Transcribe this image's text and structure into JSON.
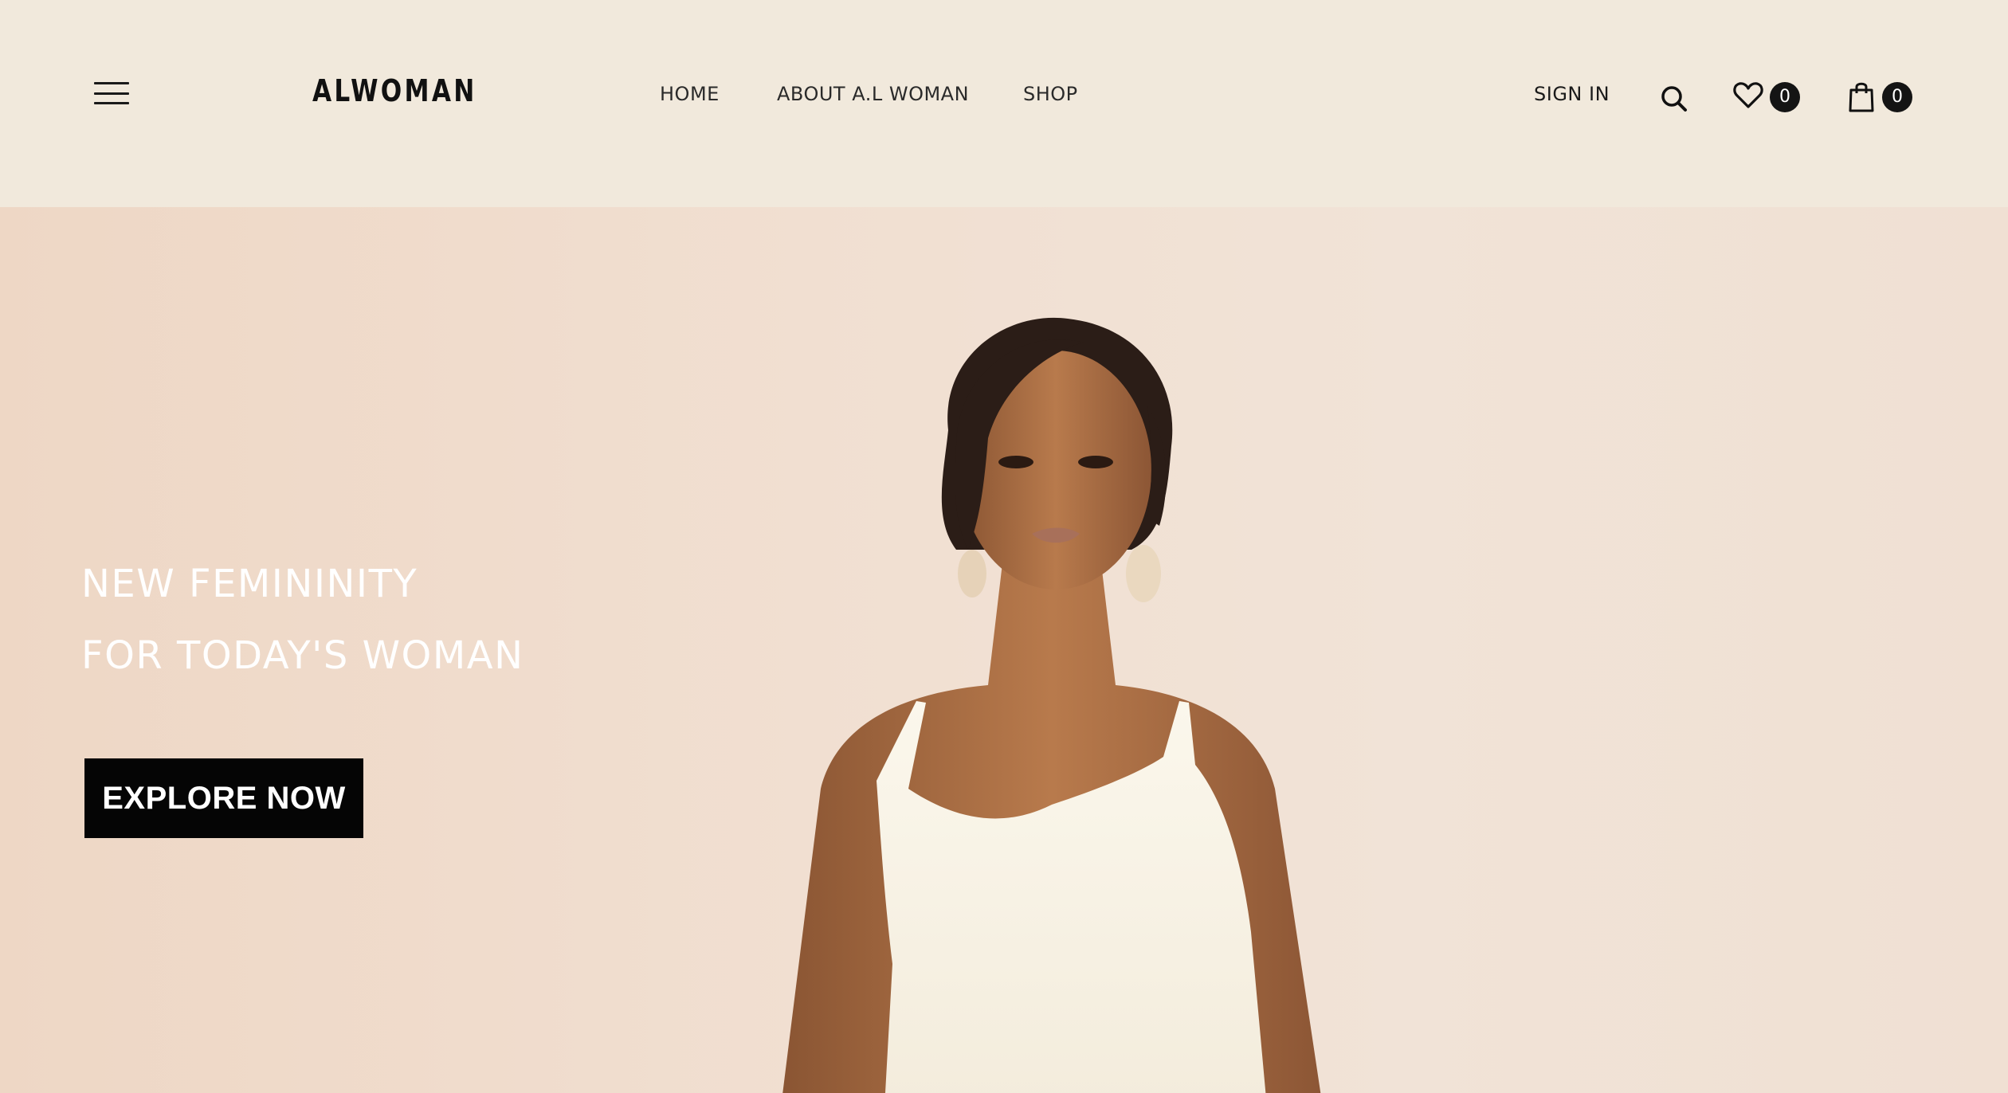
{
  "brand": {
    "logo_text": "ALWOMAN"
  },
  "nav": {
    "home": "HOME",
    "about": "ABOUT A.L WOMAN",
    "shop": "SHOP"
  },
  "account": {
    "signin": "SIGN IN",
    "wishlist_count": "0",
    "cart_count": "0"
  },
  "icons": {
    "menu": "hamburger-menu-icon",
    "search": "search-icon",
    "wishlist": "heart-icon",
    "cart": "shopping-bag-icon"
  },
  "hero": {
    "headline_line1": "NEW FEMININITY",
    "headline_line2": "FOR TODAY'S WOMAN",
    "cta_label": "EXPLORE NOW"
  },
  "colors": {
    "header_bg": "#f1e9dc",
    "hero_bg": "#efdccd",
    "button_bg": "#050505",
    "badge_bg": "#141414",
    "text_dark": "#1a1a1a"
  }
}
